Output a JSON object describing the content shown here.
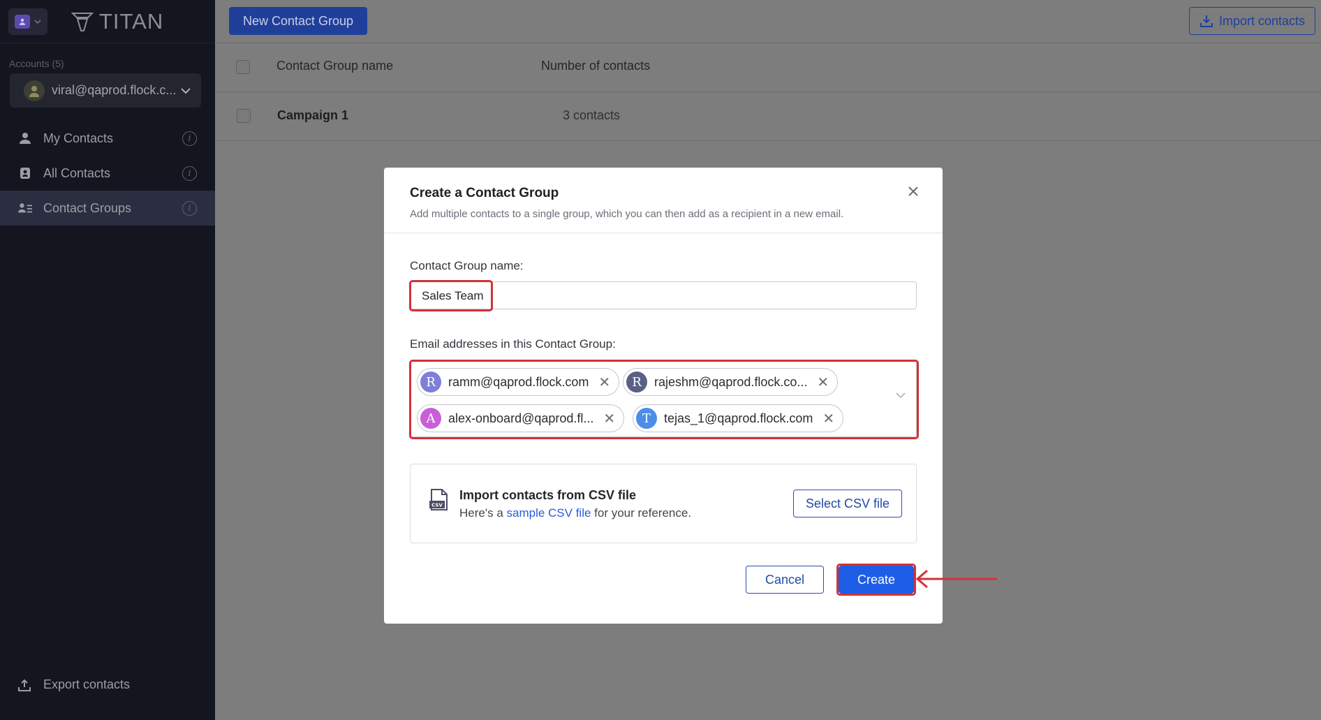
{
  "app": {
    "logo_text": "TITAN"
  },
  "sidebar": {
    "accounts_label": "Accounts (5)",
    "account_email": "viral@qaprod.flock.c...",
    "items": [
      {
        "label": "My Contacts",
        "icon": "person-icon"
      },
      {
        "label": "All Contacts",
        "icon": "contacts-book-icon"
      },
      {
        "label": "Contact Groups",
        "icon": "contact-groups-icon",
        "active": true
      }
    ],
    "info_glyph": "i",
    "export_label": "Export contacts"
  },
  "toolbar": {
    "new_group_label": "New Contact Group",
    "import_label": "Import contacts"
  },
  "table": {
    "headers": {
      "name": "Contact Group name",
      "count": "Number of contacts"
    },
    "rows": [
      {
        "name": "Campaign 1",
        "count": "3 contacts"
      }
    ]
  },
  "modal": {
    "title": "Create a Contact Group",
    "subtitle": "Add multiple contacts to a single group, which you can then add as a recipient in a new email.",
    "name_label": "Contact Group name:",
    "name_value": "Sales Team",
    "emails_label": "Email addresses in this Contact Group:",
    "chips": [
      {
        "initial": "R",
        "email": "ramm@qaprod.flock.com",
        "color": "#7d80d6"
      },
      {
        "initial": "R",
        "email": "rajeshm@qaprod.flock.co...",
        "color": "#5b5f86"
      },
      {
        "initial": "A",
        "email": "alex-onboard@qaprod.fl...",
        "color": "#c760d6"
      },
      {
        "initial": "T",
        "email": "tejas_1@qaprod.flock.com",
        "color": "#4b8de8"
      }
    ],
    "csv": {
      "title": "Import contacts from CSV file",
      "sub_prefix": "Here's a ",
      "sub_link": "sample CSV file",
      "sub_suffix": " for your reference.",
      "button": "Select CSV file",
      "icon_text": "CSV"
    },
    "cancel_label": "Cancel",
    "create_label": "Create"
  },
  "colors": {
    "highlight": "#d23236",
    "primary": "#1e5de6"
  }
}
